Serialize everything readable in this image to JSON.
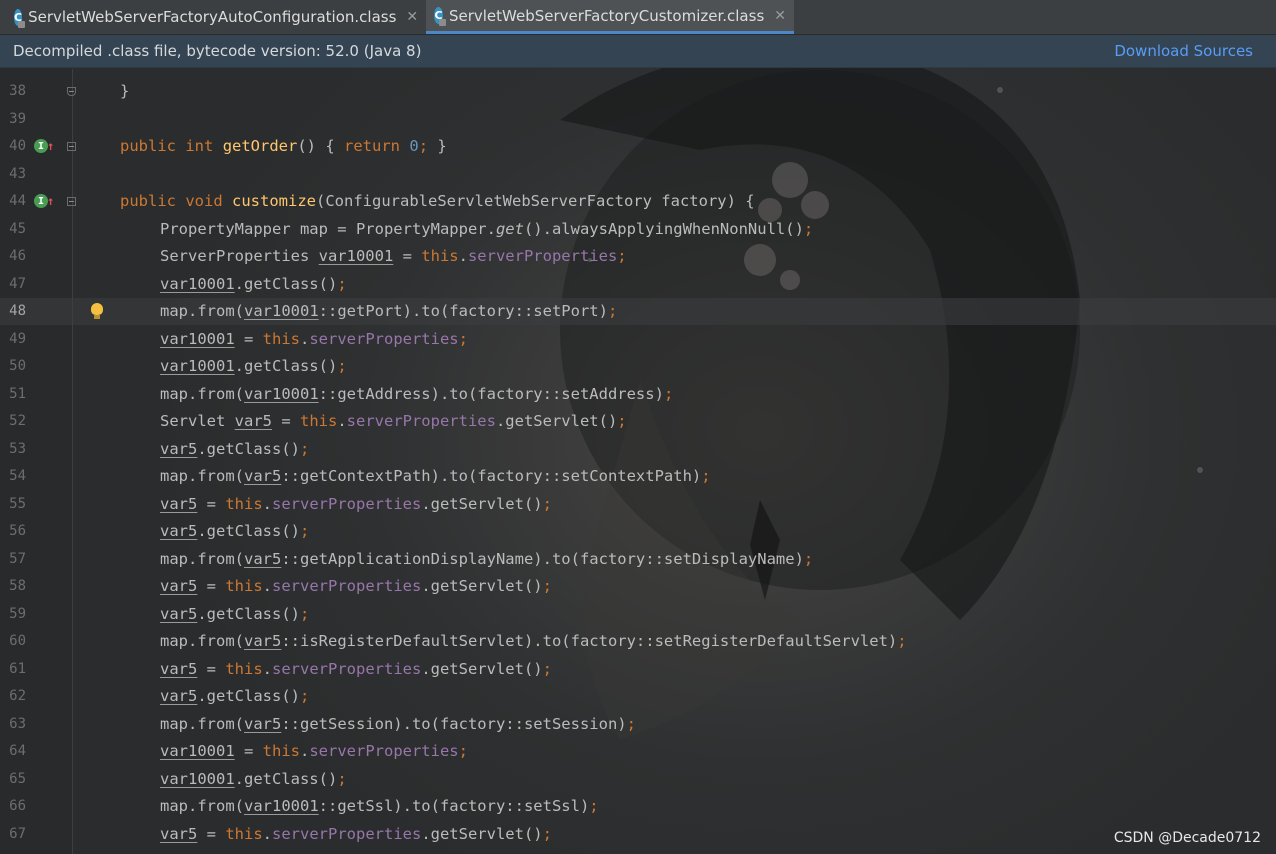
{
  "tabs": [
    {
      "label": "ServletWebServerFactoryAutoConfiguration.class",
      "icon": "class-icon",
      "active": false
    },
    {
      "label": "ServletWebServerFactoryCustomizer.class",
      "icon": "class-icon",
      "active": true
    }
  ],
  "notice": {
    "text": "Decompiled .class file, bytecode version: 52.0 (Java 8)",
    "action": "Download Sources"
  },
  "editor": {
    "current_line": "48",
    "lines": [
      {
        "num": "38",
        "text": "}"
      },
      {
        "num": "39",
        "text": ""
      },
      {
        "num": "40",
        "text": "public int getOrder() { return 0; }"
      },
      {
        "num": "43",
        "text": ""
      },
      {
        "num": "44",
        "text": "public void customize(ConfigurableServletWebServerFactory factory) {"
      },
      {
        "num": "45",
        "text": "PropertyMapper map = PropertyMapper.get().alwaysApplyingWhenNonNull();"
      },
      {
        "num": "46",
        "text": "ServerProperties var10001 = this.serverProperties;"
      },
      {
        "num": "47",
        "text": "var10001.getClass();"
      },
      {
        "num": "48",
        "text": "map.from(var10001::getPort).to(factory::setPort);"
      },
      {
        "num": "49",
        "text": "var10001 = this.serverProperties;"
      },
      {
        "num": "50",
        "text": "var10001.getClass();"
      },
      {
        "num": "51",
        "text": "map.from(var10001::getAddress).to(factory::setAddress);"
      },
      {
        "num": "52",
        "text": "Servlet var5 = this.serverProperties.getServlet();"
      },
      {
        "num": "53",
        "text": "var5.getClass();"
      },
      {
        "num": "54",
        "text": "map.from(var5::getContextPath).to(factory::setContextPath);"
      },
      {
        "num": "55",
        "text": "var5 = this.serverProperties.getServlet();"
      },
      {
        "num": "56",
        "text": "var5.getClass();"
      },
      {
        "num": "57",
        "text": "map.from(var5::getApplicationDisplayName).to(factory::setDisplayName);"
      },
      {
        "num": "58",
        "text": "var5 = this.serverProperties.getServlet();"
      },
      {
        "num": "59",
        "text": "var5.getClass();"
      },
      {
        "num": "60",
        "text": "map.from(var5::isRegisterDefaultServlet).to(factory::setRegisterDefaultServlet);"
      },
      {
        "num": "61",
        "text": "var5 = this.serverProperties.getServlet();"
      },
      {
        "num": "62",
        "text": "var5.getClass();"
      },
      {
        "num": "63",
        "text": "map.from(var5::getSession).to(factory::setSession);"
      },
      {
        "num": "64",
        "text": "var10001 = this.serverProperties;"
      },
      {
        "num": "65",
        "text": "var10001.getClass();"
      },
      {
        "num": "66",
        "text": "map.from(var10001::getSsl).to(factory::setSsl);"
      },
      {
        "num": "67",
        "text": "var5 = this.serverProperties.getServlet();"
      }
    ]
  },
  "watermark": "CSDN @Decade0712",
  "colors": {
    "keyword": "#cc7832",
    "method_decl": "#ffc66d",
    "field": "#9876aa",
    "number": "#6897bb",
    "plain": "#bbbbbb",
    "link": "#589df6"
  }
}
